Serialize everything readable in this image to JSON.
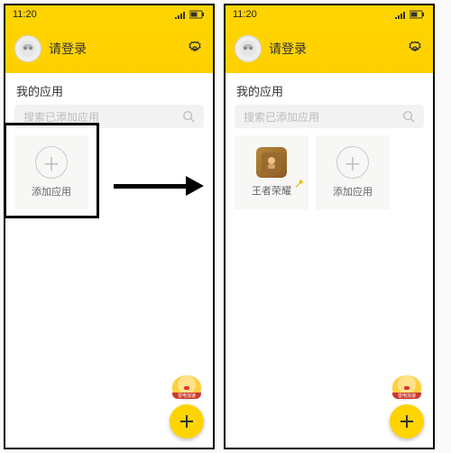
{
  "statusbar": {
    "time": "11:20"
  },
  "header": {
    "login_text": "请登录"
  },
  "section": {
    "title": "我的应用"
  },
  "search": {
    "placeholder": "搜索已添加应用"
  },
  "tiles": {
    "add_label": "添加应用",
    "app1_label": "王者荣耀"
  },
  "mascot": {
    "band": "雷电加速"
  }
}
